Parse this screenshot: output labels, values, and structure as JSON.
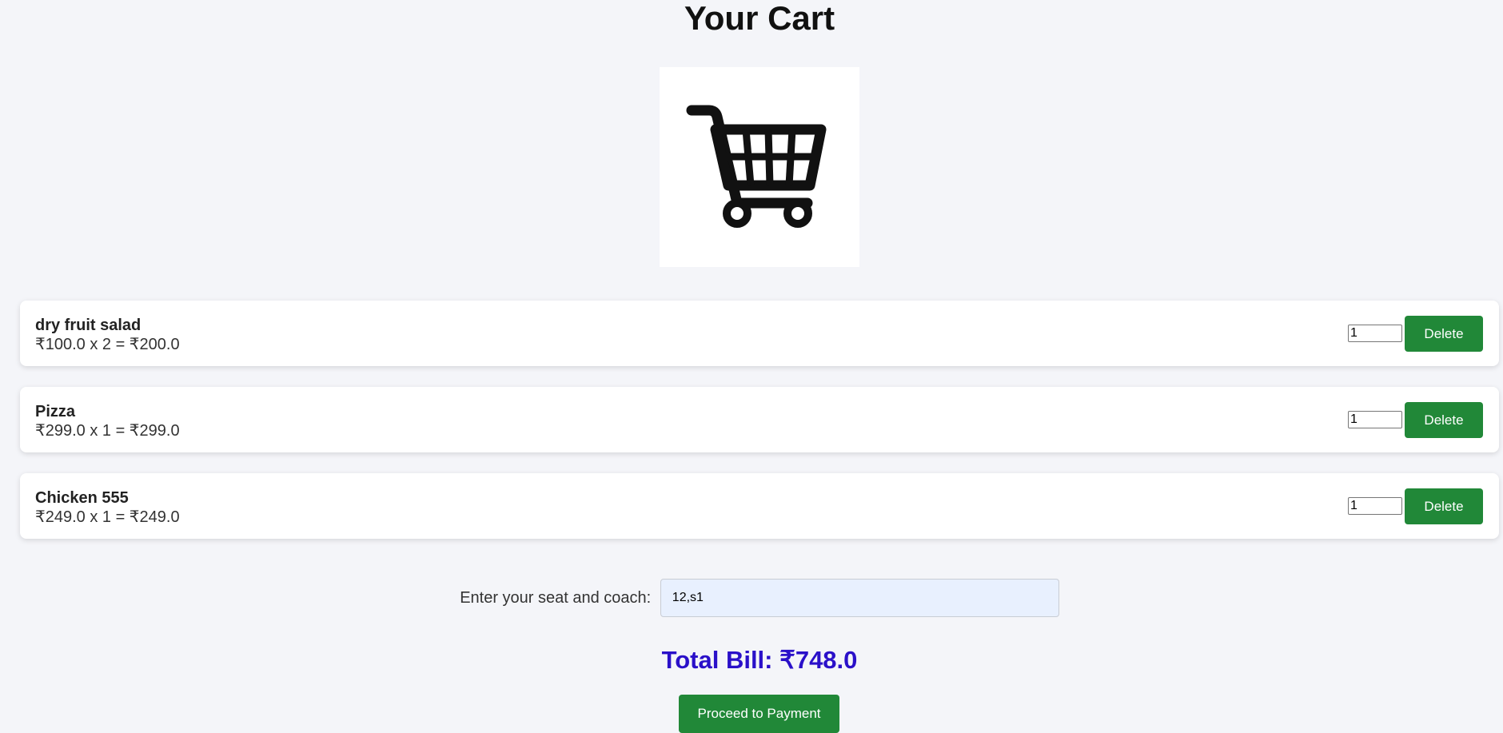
{
  "page": {
    "title": "Your Cart"
  },
  "cart_icon": "shopping-cart-icon",
  "cart": {
    "items": [
      {
        "name": "dry fruit salad",
        "price_line": "₹100.0 x 2 = ₹200.0",
        "qty": "1",
        "delete_label": "Delete"
      },
      {
        "name": "Pizza",
        "price_line": "₹299.0 x 1 = ₹299.0",
        "qty": "1",
        "delete_label": "Delete"
      },
      {
        "name": "Chicken 555",
        "price_line": "₹249.0 x 1 = ₹249.0",
        "qty": "1",
        "delete_label": "Delete"
      }
    ]
  },
  "seat": {
    "label": "Enter your seat and coach:",
    "value": "12,s1"
  },
  "total": {
    "text": "Total Bill: ₹748.0"
  },
  "payment": {
    "button_label": "Proceed to Payment"
  },
  "colors": {
    "background": "#f4f5f9",
    "button_green": "#218838",
    "total_text": "#2a10c9",
    "seat_input_bg": "#e8f0fe"
  }
}
